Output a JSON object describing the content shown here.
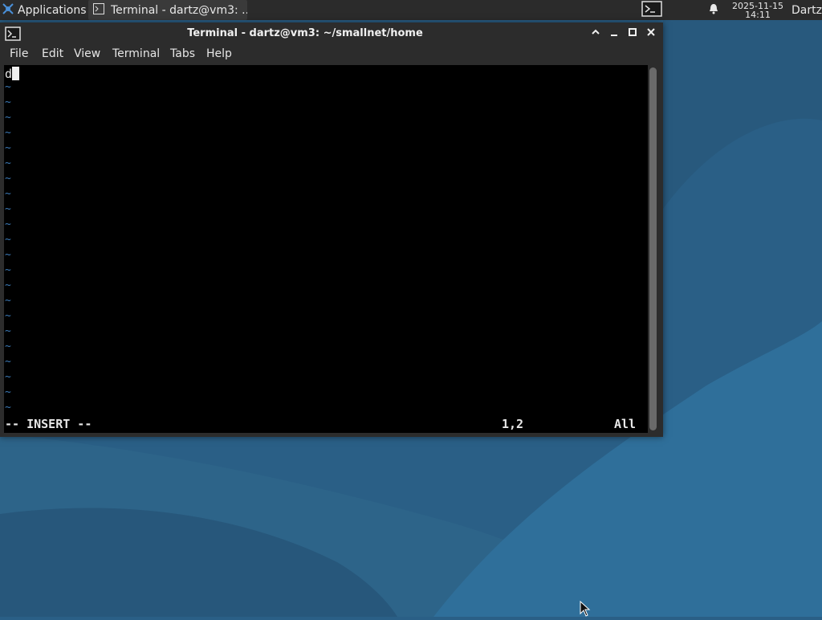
{
  "panel": {
    "applications_label": "Applications",
    "taskbar_button_label": "Terminal - dartz@vm3: ...",
    "clock_date": "2025-11-15",
    "clock_time": "14:11",
    "user_name": "Dartz"
  },
  "window": {
    "title": "Terminal - dartz@vm3: ~/smallnet/home",
    "menus": [
      "File",
      "Edit",
      "View",
      "Terminal",
      "Tabs",
      "Help"
    ]
  },
  "vim": {
    "typed_text": "d",
    "tilde_char": "~",
    "mode": "-- INSERT --",
    "position": "1,2",
    "scroll": "All"
  },
  "icons": {
    "apps": "xfce-mouse-icon",
    "terminal": "terminal-icon",
    "bell": "bell-icon"
  },
  "colors": {
    "panel_bg": "#2b2b2b",
    "window_bg": "#2c2c2c",
    "terminal_bg": "#000000",
    "tilde": "#3b79b6",
    "desktop": "#2a5f86"
  }
}
